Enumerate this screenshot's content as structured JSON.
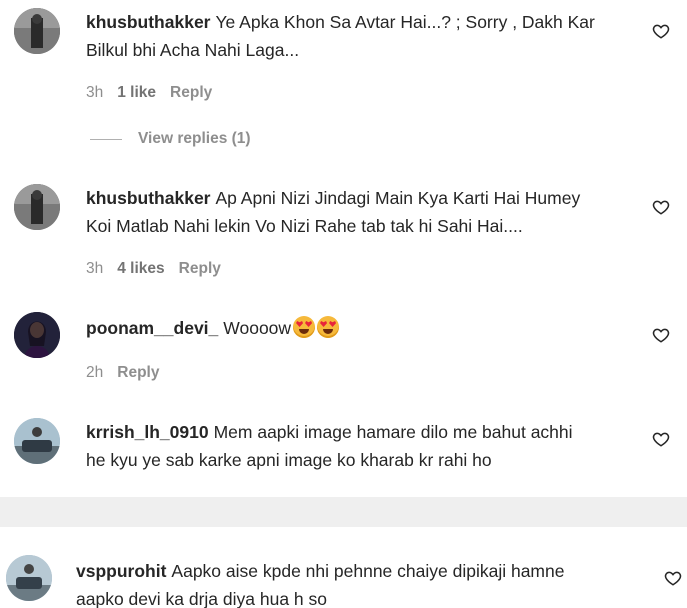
{
  "comments": [
    {
      "username": "khusbuthakker",
      "text_line1": "Ye Apka Khon Sa Avtar Hai...? ; Sorry , Dakh Kar",
      "text_line2": "Bilkul bhi Acha Nahi Laga...",
      "time": "3h",
      "likes": "1 like",
      "reply": "Reply",
      "view_replies": "View replies (1)"
    },
    {
      "username": "khusbuthakker",
      "text_line1": "Ap Apni Nizi Jindagi Main Kya Karti Hai Humey",
      "text_line2": "Koi Matlab Nahi lekin Vo Nizi Rahe tab tak hi Sahi Hai....",
      "time": "3h",
      "likes": "4 likes",
      "reply": "Reply"
    },
    {
      "username": "poonam__devi_",
      "text_line1": "Woooow",
      "time": "2h",
      "reply": "Reply"
    },
    {
      "username": "krrish_lh_0910",
      "text_line1": "Mem aapki image hamare dilo me bahut achhi",
      "text_line2": "he kyu ye sab karke apni image ko kharab kr rahi ho"
    },
    {
      "username": "vsppurohit",
      "text_line1": "Aapko aise kpde nhi pehnne chaiye dipikaji hamne",
      "text_line2": "aapko devi ka drja diya hua h so"
    }
  ],
  "icons": {
    "like": "heart-outline-icon",
    "emoji": "star-struck-emoji"
  },
  "colors": {
    "text": "#262626",
    "muted": "#8e8e8e",
    "divider_band": "#efefef"
  }
}
